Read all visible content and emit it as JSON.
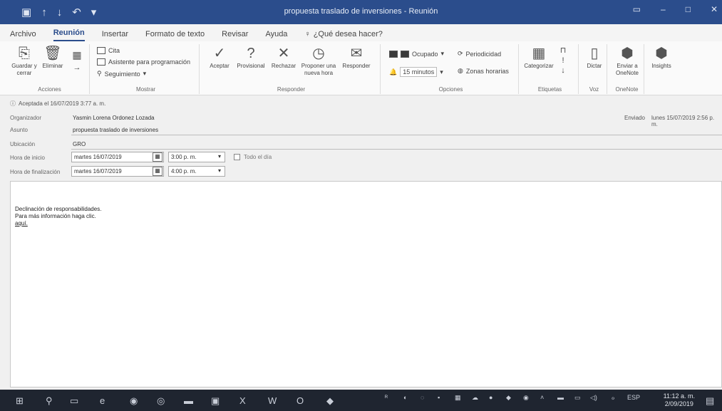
{
  "window": {
    "title": "propuesta traslado de inversiones - Reunión"
  },
  "tabs": [
    {
      "label": "Archivo"
    },
    {
      "label": "Reunión"
    },
    {
      "label": "Insertar"
    },
    {
      "label": "Formato de texto"
    },
    {
      "label": "Revisar"
    },
    {
      "label": "Ayuda"
    }
  ],
  "tellme": "¿Qué desea hacer?",
  "ribbon": {
    "acciones": {
      "label": "Acciones",
      "guardar": "Guardar y cerrar",
      "eliminar": "Eliminar"
    },
    "mostrar": {
      "label": "Mostrar",
      "cita": "Cita",
      "asistente": "Asistente para programación",
      "seguimiento": "Seguimiento"
    },
    "responder": {
      "label": "Responder",
      "aceptar": "Aceptar",
      "provisional": "Provisional",
      "rechazar": "Rechazar",
      "proponer": "Proponer una nueva hora",
      "responder": "Responder"
    },
    "opciones": {
      "label": "Opciones",
      "estado": "Ocupado",
      "periodicidad": "Periodicidad",
      "recordatorio": "15 minutos",
      "zonas": "Zonas horarias"
    },
    "etiquetas": {
      "label": "Etiquetas",
      "categorizar": "Categorizar"
    },
    "voz": {
      "label": "Voz",
      "dictar": "Dictar"
    },
    "onenote": {
      "label": "OneNote",
      "enviar": "Enviar a OneNote"
    },
    "insights": "Insights"
  },
  "infobar": "Aceptada el 16/07/2019 3:77 a. m.",
  "form": {
    "organizador_label": "Organizador",
    "organizador": "Yasmin Lorena Ordonez Lozada",
    "enviado_label": "Enviado",
    "enviado": "lunes 15/07/2019 2:56 p. m.",
    "asunto_label": "Asunto",
    "asunto": "propuesta traslado de inversiones",
    "ubicacion_label": "Ubicación",
    "ubicacion": "GRO",
    "inicio_label": "Hora de inicio",
    "inicio_fecha": "martes 16/07/2019",
    "inicio_hora": "3:00 p. m.",
    "todo_el_dia": "Todo el día",
    "fin_label": "Hora de finalización",
    "fin_fecha": "martes 16/07/2019",
    "fin_hora": "4:00 p. m."
  },
  "body": {
    "line1": "Declinación de responsabilidades.",
    "line2": "Para más información haga clic.",
    "line3": "aquí."
  },
  "taskbar": {
    "lang": "ESP",
    "time": "11:12 a. m.",
    "date": "2/09/2019"
  }
}
